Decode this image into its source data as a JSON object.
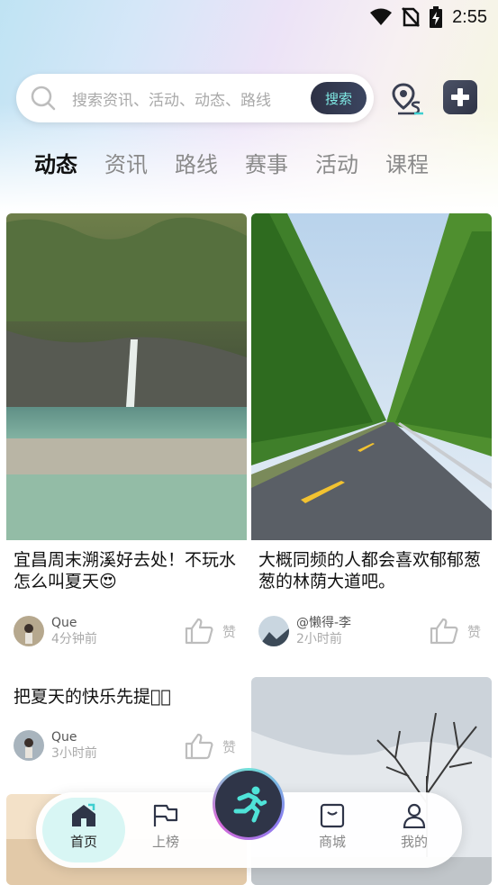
{
  "status_bar": {
    "time": "2:55"
  },
  "search": {
    "placeholder": "搜索资讯、活动、动态、路线",
    "button_label": "搜索"
  },
  "tabs": [
    {
      "label": "动态",
      "active": true
    },
    {
      "label": "资讯",
      "active": false
    },
    {
      "label": "路线",
      "active": false
    },
    {
      "label": "赛事",
      "active": false
    },
    {
      "label": "活动",
      "active": false
    },
    {
      "label": "课程",
      "active": false
    }
  ],
  "cards": [
    {
      "title": "宜昌周末溯溪好去处！不玩水怎么叫夏天😍",
      "author": "Que",
      "time": "4分钟前",
      "like_label": "赞"
    },
    {
      "title": "大概同频的人都会喜欢郁郁葱葱的林荫大道吧。",
      "author": "@懒得-李",
      "time": "2小时前",
      "like_label": "赞"
    },
    {
      "title": "把夏天的快乐先提前🏻",
      "author": "Que",
      "time": "3小时前",
      "like_label": "赞"
    }
  ],
  "bottom_nav": [
    {
      "label": "首页",
      "icon": "home-icon",
      "active": true
    },
    {
      "label": "上榜",
      "icon": "flag-icon",
      "active": false
    },
    {
      "label": "商城",
      "icon": "shopping-bag-icon",
      "active": false
    },
    {
      "label": "我的",
      "icon": "person-icon",
      "active": false
    }
  ],
  "colors": {
    "accent": "#3ecfd0",
    "dark": "#2f3548",
    "search_text": "#7fe9e4"
  }
}
